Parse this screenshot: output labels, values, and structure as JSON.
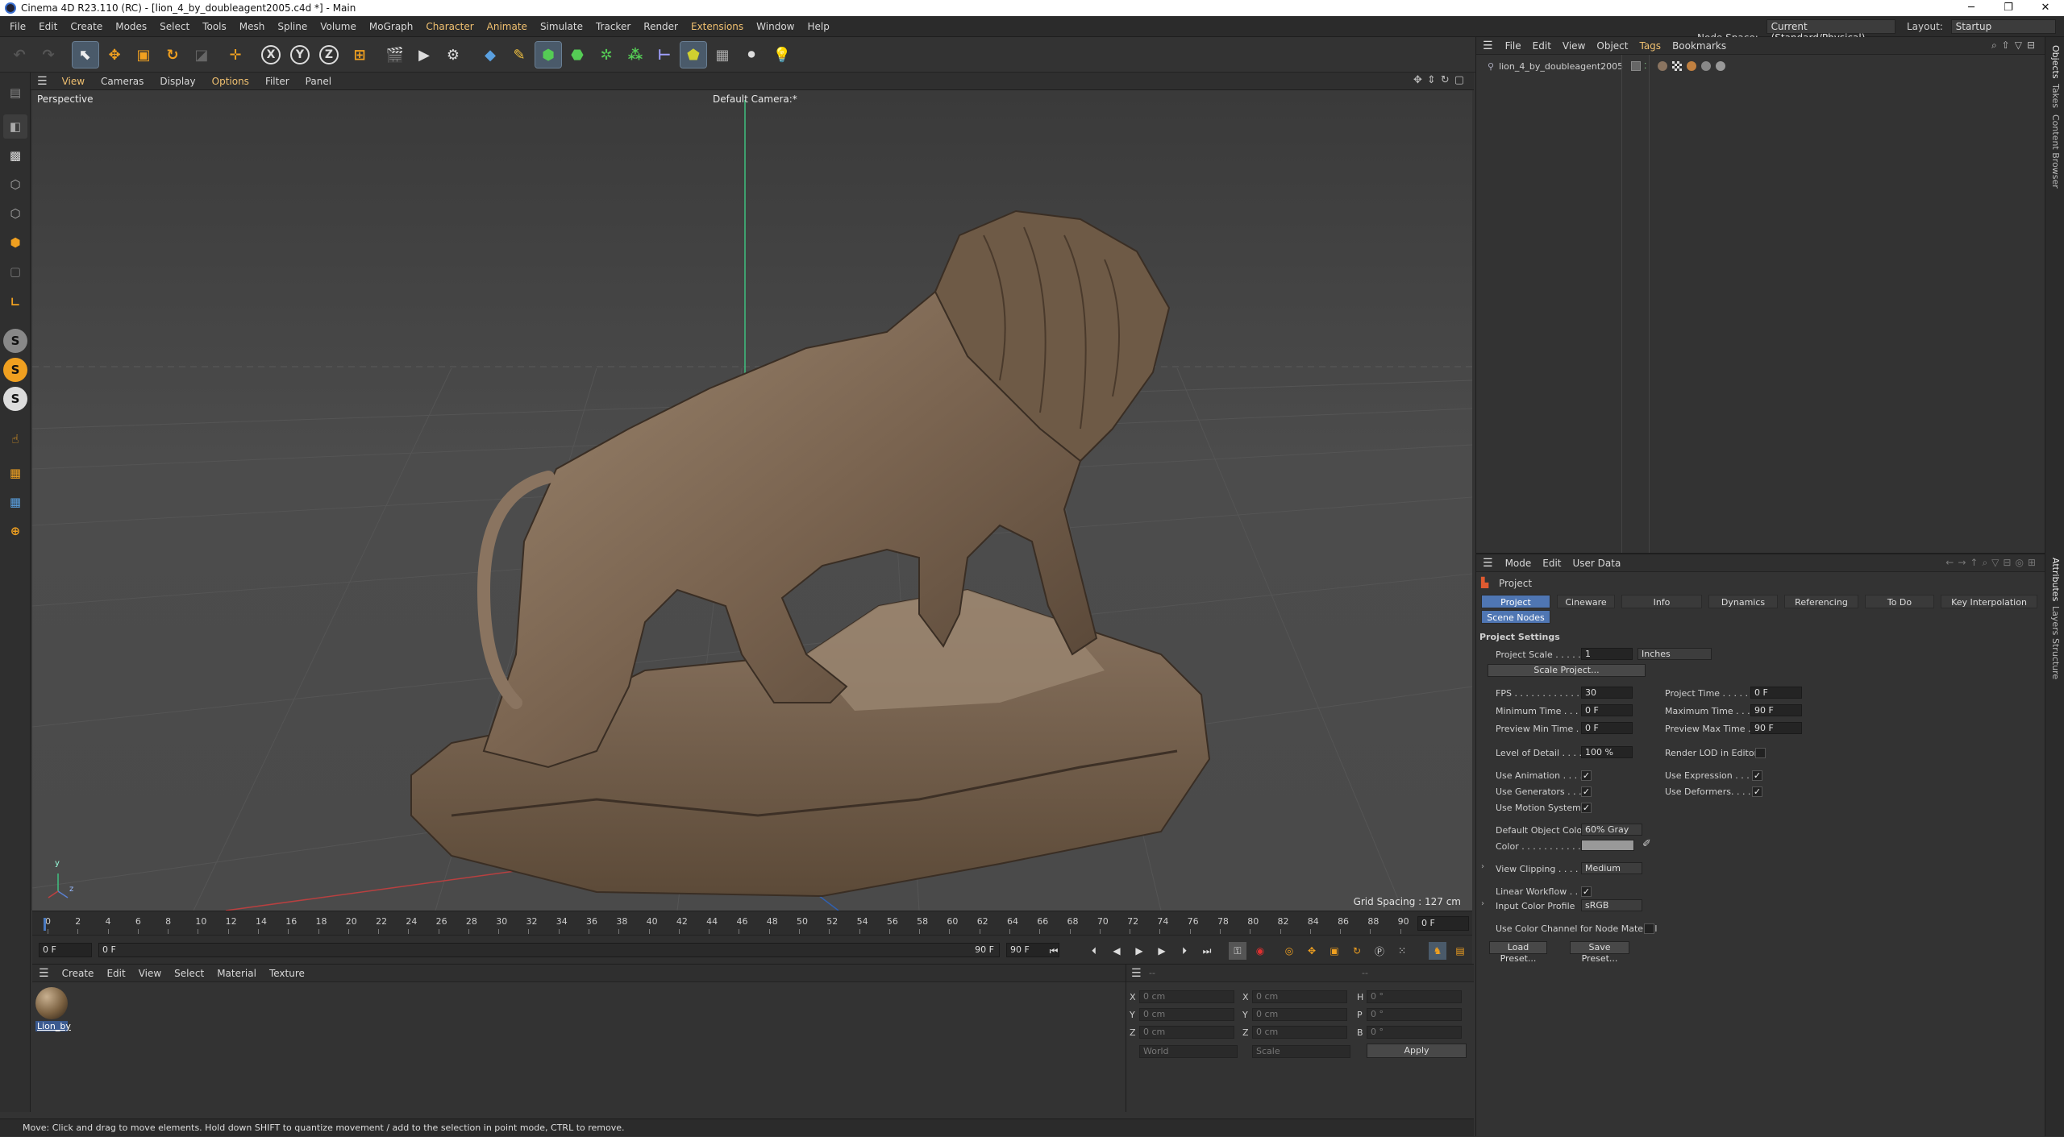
{
  "window": {
    "title": "Cinema 4D R23.110 (RC) - [lion_4_by_doubleagent2005.c4d *] - Main",
    "minimize": "─",
    "maximize": "❐",
    "close": "✕"
  },
  "menubar": {
    "items": [
      "File",
      "Edit",
      "Create",
      "Modes",
      "Select",
      "Tools",
      "Mesh",
      "Spline",
      "Volume",
      "MoGraph",
      "Character",
      "Animate",
      "Simulate",
      "Tracker",
      "Render",
      "Extensions",
      "Window",
      "Help"
    ],
    "node_space_label": "Node Space:",
    "node_space_value": "Current (Standard/Physical)",
    "layout_label": "Layout:",
    "layout_value": "Startup"
  },
  "toolbar": {
    "icons": [
      "undo-icon",
      "redo-icon",
      "live-selection-icon",
      "move-icon",
      "scale-icon",
      "rotate-icon",
      "recent-tool-icon",
      "transfer-icon",
      "x-axis-icon",
      "y-axis-icon",
      "z-axis-icon",
      "coordinate-system-icon",
      "render-region-icon",
      "render-view-icon",
      "render-settings-icon",
      "cube-icon",
      "pen-icon",
      "subdivision-icon",
      "extrude-icon",
      "cloner-icon",
      "deformer-icon",
      "measure-icon",
      "floor-icon",
      "camera-icon",
      "light-icon"
    ],
    "axis_x": "X",
    "axis_y": "Y",
    "axis_z": "Z"
  },
  "viewport": {
    "menu": [
      "View",
      "Cameras",
      "Display",
      "Options",
      "Filter",
      "Panel"
    ],
    "projection": "Perspective",
    "camera": "Default Camera",
    "camera_suffix": ":*",
    "grid_spacing": "Grid Spacing : 127 cm",
    "axis_y": "y",
    "axis_z": "z"
  },
  "timeline": {
    "ticks": [
      "0",
      "2",
      "4",
      "6",
      "8",
      "10",
      "12",
      "14",
      "16",
      "18",
      "20",
      "22",
      "24",
      "26",
      "28",
      "30",
      "32",
      "34",
      "36",
      "38",
      "40",
      "42",
      "44",
      "46",
      "48",
      "50",
      "52",
      "54",
      "56",
      "58",
      "60",
      "62",
      "64",
      "66",
      "68",
      "70",
      "72",
      "74",
      "76",
      "78",
      "80",
      "82",
      "84",
      "86",
      "88",
      "90"
    ],
    "current_frame": "0 F"
  },
  "timecontrols": {
    "start": "0 F",
    "range_start": "0 F",
    "range_end": "90 F",
    "end": "90 F"
  },
  "material_manager": {
    "menu": [
      "Create",
      "Edit",
      "View",
      "Select",
      "Material",
      "Texture"
    ],
    "material_name": "Lion_by"
  },
  "coordinates": {
    "rows": [
      {
        "a": "X",
        "av": "0 cm",
        "b": "X",
        "bv": "0 cm",
        "c": "H",
        "cv": "0 °"
      },
      {
        "a": "Y",
        "av": "0 cm",
        "b": "Y",
        "bv": "0 cm",
        "c": "P",
        "cv": "0 °"
      },
      {
        "a": "Z",
        "av": "0 cm",
        "b": "Z",
        "bv": "0 cm",
        "c": "B",
        "cv": "0 °"
      }
    ],
    "dash1": "--",
    "dash2": "--",
    "world": "World",
    "scale": "Scale",
    "apply": "Apply"
  },
  "status": "Move: Click and drag to move elements. Hold down SHIFT to quantize movement / add to the selection in point mode, CTRL to remove.",
  "object_manager": {
    "menu": [
      "File",
      "Edit",
      "View",
      "Object",
      "Tags",
      "Bookmarks"
    ],
    "object_name": "lion_4_by_doubleagent2005"
  },
  "attributes": {
    "menu": [
      "Mode",
      "Edit",
      "User Data"
    ],
    "header": "Project",
    "tabs": [
      "Project Settings",
      "Cineware",
      "Info",
      "Dynamics",
      "Referencing",
      "To Do",
      "Key Interpolation"
    ],
    "tab2": "Scene Nodes",
    "section": "Project Settings",
    "project_scale_label": "Project Scale . . . . .",
    "project_scale": "1",
    "project_scale_unit": "Inches",
    "scale_project_btn": "Scale Project...",
    "fps_label": "FPS . . . . . . . . . . . . .",
    "fps": "30",
    "project_time_label": "Project Time . . . . .",
    "project_time": "0 F",
    "min_time_label": "Minimum Time . . . .",
    "min_time": "0 F",
    "max_time_label": "Maximum Time . . .",
    "max_time": "90 F",
    "prev_min_label": "Preview Min Time . .",
    "prev_min": "0 F",
    "prev_max_label": "Preview Max Time . .",
    "prev_max": "90 F",
    "lod_label": "Level of Detail . . . .",
    "lod": "100 %",
    "render_lod_label": "Render LOD in Editor",
    "use_anim_label": "Use Animation . . . .",
    "use_expr_label": "Use Expression . . . .",
    "use_gen_label": "Use Generators . . .",
    "use_def_label": "Use Deformers. . . .",
    "use_motion_label": "Use Motion System",
    "def_color_label": "Default Object Color",
    "def_color": "60% Gray",
    "color_label": "Color . . . . . . . . . . .",
    "view_clip_label": "View Clipping . . . . .",
    "view_clip": "Medium",
    "linear_wf_label": "Linear Workflow . . .",
    "input_profile_label": "Input Color Profile",
    "input_profile": "sRGB",
    "use_color_channel_label": "Use Color Channel for Node Material",
    "load_preset": "Load Preset...",
    "save_preset": "Save Preset...",
    "check": "✓"
  },
  "side_tabs": [
    "Objects",
    "Takes",
    "Content Browser",
    "Attributes",
    "Layers",
    "Structure"
  ]
}
